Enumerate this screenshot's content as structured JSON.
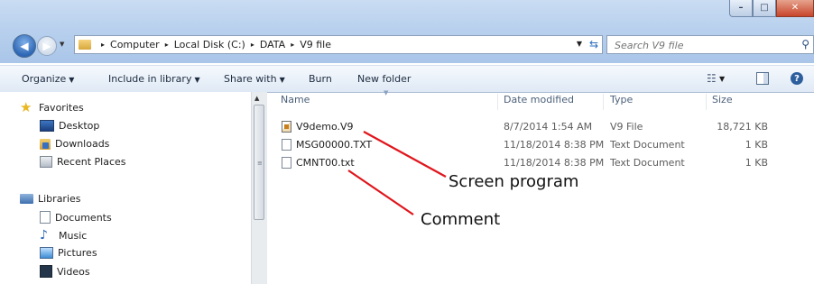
{
  "window": {
    "caption_buttons": [
      {
        "name": "minimize-button",
        "glyph": "–"
      },
      {
        "name": "maximize-button",
        "glyph": "□"
      },
      {
        "name": "close-button",
        "glyph": "✕"
      }
    ]
  },
  "address_bar": {
    "breadcrumbs": [
      "Computer",
      "Local Disk (C:)",
      "DATA",
      "V9 file"
    ],
    "separator": "▸"
  },
  "search": {
    "placeholder": "Search V9 file"
  },
  "command_bar": {
    "organize": "Organize",
    "include_in_library": "Include in library",
    "share_with": "Share with",
    "burn": "Burn",
    "new_folder": "New folder",
    "help": "?"
  },
  "nav_pane": {
    "favorites": {
      "label": "Favorites",
      "items": [
        "Desktop",
        "Downloads",
        "Recent Places"
      ]
    },
    "libraries": {
      "label": "Libraries",
      "items": [
        "Documents",
        "Music",
        "Pictures",
        "Videos"
      ]
    }
  },
  "file_list": {
    "columns": [
      "Name",
      "Date modified",
      "Type",
      "Size"
    ],
    "rows": [
      {
        "name": "V9demo.V9",
        "date": "8/7/2014 1:54 AM",
        "type": "V9 File",
        "size": "18,721 KB",
        "icon": "v9-file-icon"
      },
      {
        "name": "MSG00000.TXT",
        "date": "11/18/2014 8:38 PM",
        "type": "Text Document",
        "size": "1 KB",
        "icon": "text-file-icon"
      },
      {
        "name": "CMNT00.txt",
        "date": "11/18/2014 8:38 PM",
        "type": "Text Document",
        "size": "1 KB",
        "icon": "text-file-icon"
      }
    ]
  },
  "annotations": {
    "screen_program": "Screen program",
    "comment": "Comment",
    "line_color": "#e0161c"
  }
}
